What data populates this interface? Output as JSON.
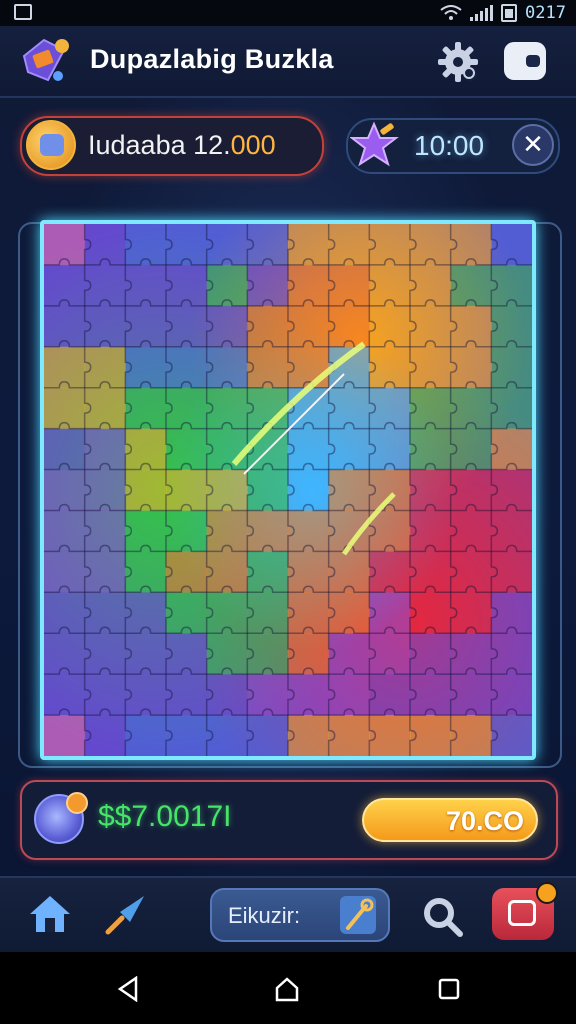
{
  "status_bar": {
    "time": "0217"
  },
  "header": {
    "title": "Dupazlabig Buzkla"
  },
  "player": {
    "label_main": "Iudaaba 12.",
    "label_highlight": "000"
  },
  "timer": {
    "value": "10:00",
    "close_glyph": "✕"
  },
  "wallet": {
    "balance": "$$7.0017I",
    "action_value": "70.CO"
  },
  "bottom_nav": {
    "center_label": "Eikuzir:"
  },
  "colors": {
    "accent_cyan": "#7fe9ff",
    "money_green": "#46e56a",
    "gold": "#f59a1b",
    "danger_red": "#e8515b"
  },
  "icons": [
    "app-logo-icon",
    "settings-gear-icon",
    "wallet-icon",
    "avatar-icon",
    "star-icon",
    "close-icon",
    "coin-icon",
    "home-icon",
    "wand-icon",
    "key-icon",
    "search-gear-icon",
    "shop-icon",
    "back-icon",
    "home-circle-icon",
    "recents-icon"
  ]
}
